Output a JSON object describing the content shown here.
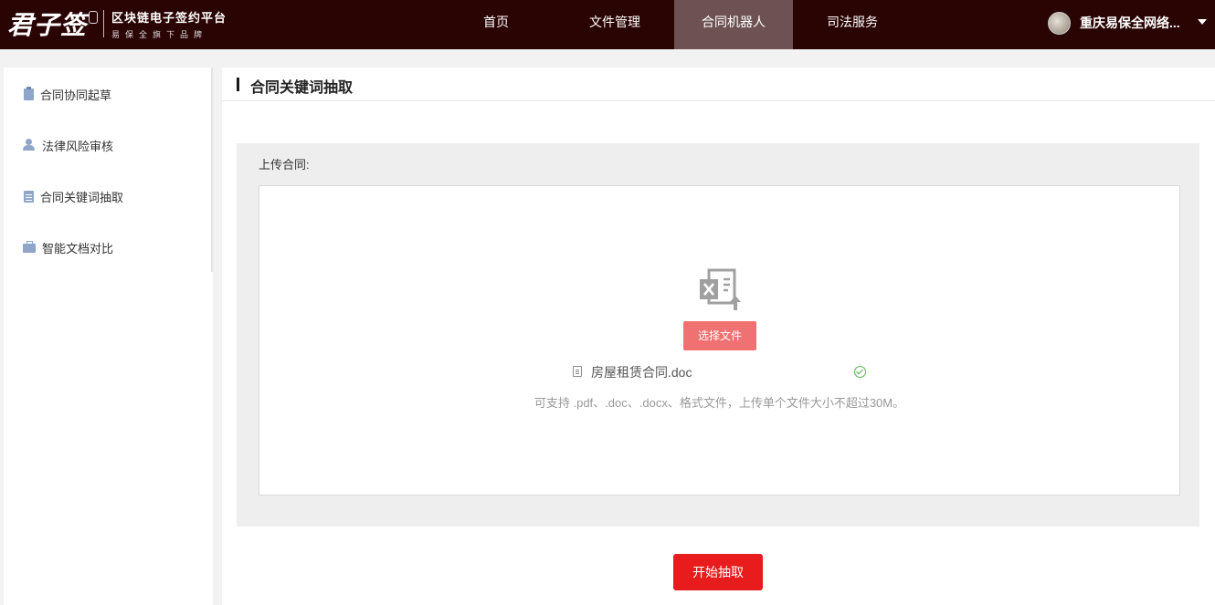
{
  "header": {
    "logo_main": "君子签",
    "logo_tagline": "区块链电子签约平台",
    "logo_subline": "易保全旗下品牌",
    "nav": [
      {
        "label": "首页"
      },
      {
        "label": "文件管理"
      },
      {
        "label": "合同机器人"
      },
      {
        "label": "司法服务"
      }
    ],
    "active_nav": "合同机器人",
    "user_name": "重庆易保全网络..."
  },
  "sidebar": {
    "items": [
      {
        "label": "合同协同起草",
        "icon": "clipboard-icon"
      },
      {
        "label": "法律风险审核",
        "icon": "user-icon"
      },
      {
        "label": "合同关键词抽取",
        "icon": "document-icon"
      },
      {
        "label": "智能文档对比",
        "icon": "briefcase-icon"
      }
    ]
  },
  "main": {
    "title": "合同关键词抽取",
    "upload_label": "上传合同:",
    "choose_button": "选择文件",
    "uploaded_file": {
      "name": "房屋租赁合同.doc",
      "status": "success"
    },
    "hint": "可支持 .pdf、.doc、.docx、格式文件，上传单个文件大小不超过30M。",
    "start_button": "开始抽取"
  },
  "colors": {
    "topbar": "#2a0303",
    "nav_active": "#6e5253",
    "choose_button": "#f07171",
    "start_button": "#e81c1c",
    "sidebar_icon": "#8fa6c9",
    "success": "#52b152"
  }
}
